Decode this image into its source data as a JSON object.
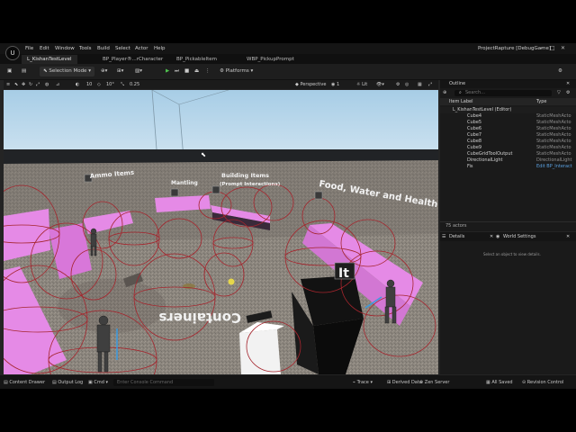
{
  "menu": {
    "items": [
      "File",
      "Edit",
      "Window",
      "Tools",
      "Build",
      "Select",
      "Actor",
      "Help"
    ],
    "project": "ProjectRapture [DebugGame]"
  },
  "tabs": [
    {
      "label": "L_KishanTestLevel",
      "active": true
    },
    {
      "label": "BP_Player®...rCharacter",
      "active": false
    },
    {
      "label": "BP_PickableItem",
      "active": false
    },
    {
      "label": "WBP_PickupPrompt",
      "active": false
    }
  ],
  "toolbar": {
    "mode": "Selection Mode",
    "platforms": "Platforms"
  },
  "viewport_toolbar": {
    "snap_values": [
      "10",
      "10°",
      "0.25"
    ],
    "perspective": "Perspective",
    "lit": "Lit",
    "show_count": "1"
  },
  "viewport_labels": {
    "ammo": "Ammo Items",
    "mantling": "Mantling",
    "building_1": "Building Items",
    "building_2": "(Prompt Interactions)",
    "food": "Food, Water and Health Items",
    "containers": "Containers",
    "mirrored_text_note": "Containers"
  },
  "outliner": {
    "title": "Outline",
    "search_placeholder": "Search...",
    "col_label": "Item Label",
    "col_type": "Type",
    "root": "L_KishanTestLevel (Editor)",
    "rows": [
      {
        "name": "Cube4",
        "type": "StaticMeshActo"
      },
      {
        "name": "Cube5",
        "type": "StaticMeshActo"
      },
      {
        "name": "Cube6",
        "type": "StaticMeshActo"
      },
      {
        "name": "Cube7",
        "type": "StaticMeshActo"
      },
      {
        "name": "Cube8",
        "type": "StaticMeshActo"
      },
      {
        "name": "Cube9",
        "type": "StaticMeshActo"
      },
      {
        "name": "CubeGridToolOutput",
        "type": "StaticMeshActo"
      },
      {
        "name": "DirectionalLight",
        "type": "DirectionalLight"
      },
      {
        "name": "Fis",
        "type": "Edit BP_Interact"
      }
    ],
    "actor_count": "75 actors"
  },
  "details": {
    "tab_details": "Details",
    "tab_world": "World Settings",
    "empty_msg": "Select an object to view details."
  },
  "statusbar": {
    "content_drawer": "Content Drawer",
    "output_log": "Output Log",
    "cmd": "Cmd",
    "console_placeholder": "Enter Console Command",
    "trace": "Trace",
    "derived": "Derived Data",
    "zen": "Zen Server",
    "saved": "All Saved",
    "revision": "Revision Control"
  },
  "colors": {
    "accent_pink": "#e58ae6",
    "debug_sphere": "#a5252d",
    "ui_bg": "#242424",
    "sky": "#a9cde4"
  }
}
